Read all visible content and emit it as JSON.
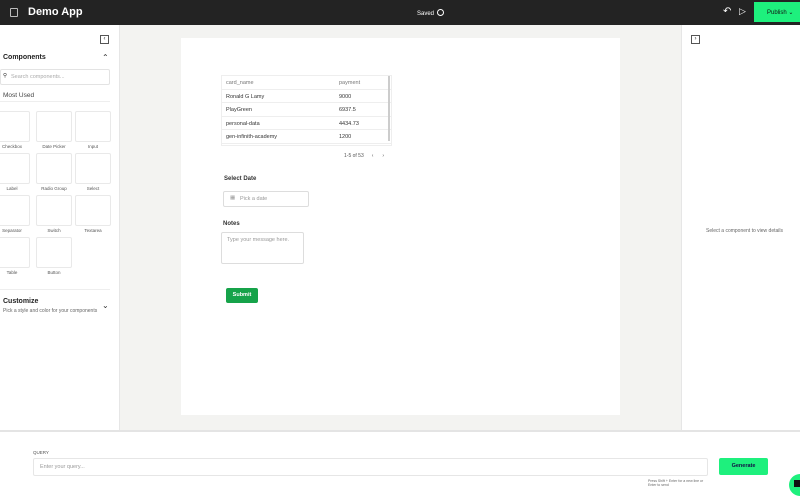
{
  "header": {
    "title": "Demo App",
    "status": "Saved",
    "publish": "Publish"
  },
  "left": {
    "section": "Components",
    "search_placeholder": "Search components...",
    "most_used": "Most Used",
    "components": [
      "Checkbox",
      "Date Picker",
      "Input",
      "Label",
      "Radio Group",
      "Select",
      "Separator",
      "Switch",
      "Textarea",
      "Table",
      "Button"
    ],
    "customize": "Customize",
    "customize_desc": "Pick a style and color for your components"
  },
  "table": {
    "columns": [
      "card_name",
      "payment"
    ],
    "rows": [
      [
        "Ronald G Lamy",
        "9000"
      ],
      [
        "PlayGreen",
        "6937.5"
      ],
      [
        "personal-data",
        "4434.73"
      ],
      [
        "gen-infinith-academy",
        "1200"
      ]
    ],
    "pagination": "1-5 of 53"
  },
  "form": {
    "date_label": "Select Date",
    "date_placeholder": "Pick a date",
    "notes_label": "Notes",
    "notes_placeholder": "Type your message here.",
    "submit": "Submit"
  },
  "right": {
    "empty": "Select a component to view details"
  },
  "query": {
    "label": "QUERY",
    "placeholder": "Enter your query...",
    "generate": "Generate",
    "hint": "Press Shift + Enter for a new line or Enter to send"
  }
}
